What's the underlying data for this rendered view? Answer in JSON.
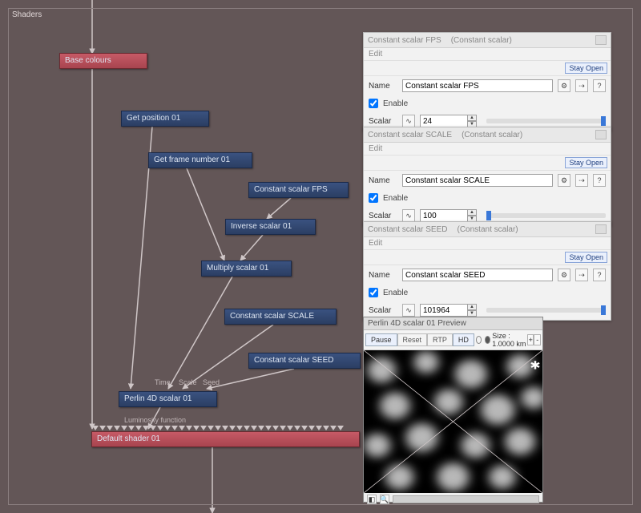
{
  "frame": {
    "title": "Shaders"
  },
  "nodes": {
    "base_colours": "Base colours",
    "get_position": "Get position 01",
    "get_frame": "Get frame number 01",
    "const_fps": "Constant scalar FPS",
    "inverse": "Inverse scalar 01",
    "multiply": "Multiply scalar 01",
    "const_scale": "Constant scalar SCALE",
    "const_seed": "Constant scalar SEED",
    "perlin": "Perlin 4D scalar 01",
    "default_shader": "Default shader 01"
  },
  "port_labels": {
    "time": "Time",
    "scale": "Scale",
    "seed": "Seed",
    "lum": "Luminosity function"
  },
  "panels": [
    {
      "title": "Constant scalar FPS",
      "type": "(Constant scalar)",
      "edit": "Edit",
      "stay_open": "Stay Open",
      "name_label": "Name",
      "name_value": "Constant scalar FPS",
      "enable_label": "Enable",
      "enable": true,
      "scalar_label": "Scalar",
      "scalar_value": "24",
      "help": "?"
    },
    {
      "title": "Constant scalar SCALE",
      "type": "(Constant scalar)",
      "edit": "Edit",
      "stay_open": "Stay Open",
      "name_label": "Name",
      "name_value": "Constant scalar SCALE",
      "enable_label": "Enable",
      "enable": true,
      "scalar_label": "Scalar",
      "scalar_value": "100",
      "help": "?"
    },
    {
      "title": "Constant scalar SEED",
      "type": "(Constant scalar)",
      "edit": "Edit",
      "stay_open": "Stay Open",
      "name_label": "Name",
      "name_value": "Constant scalar SEED",
      "enable_label": "Enable",
      "enable": true,
      "scalar_label": "Scalar",
      "scalar_value": "101964",
      "help": "?"
    }
  ],
  "preview": {
    "title": "Perlin 4D scalar 01 Preview",
    "pause": "Pause",
    "reset": "Reset",
    "rtp": "RTP",
    "hd": "HD",
    "size_label": "Size : 1.0000 km",
    "plus": "+",
    "minus": "-"
  }
}
